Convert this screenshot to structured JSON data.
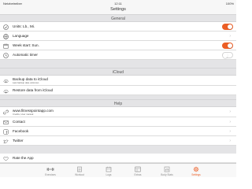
{
  "status_bar": {
    "carrier": "Netzbetreiber",
    "time": "12:11",
    "battery": "100%"
  },
  "nav": {
    "title": "Settings"
  },
  "sections": {
    "general": "General",
    "icloud": "iCloud",
    "help": "Help"
  },
  "general": {
    "units": {
      "label": "Units: Lb., Mi.",
      "on": true
    },
    "language": {
      "label": "Language"
    },
    "week_start": {
      "label": "Week start: Sun.",
      "on": true
    },
    "auto_timer": {
      "label": "Automatic timer",
      "on": false
    }
  },
  "icloud": {
    "backup": {
      "label": "Backup data to iCloud",
      "sub": "Last backup date unknown"
    },
    "restore": {
      "label": "Restore data from iCloud"
    }
  },
  "help": {
    "website": {
      "label": "www.fitnesspointapp.com",
      "sub": "Credits, User manual"
    },
    "contact": {
      "label": "Contact"
    },
    "facebook": {
      "label": "Facebook"
    },
    "twitter": {
      "label": "Twitter"
    }
  },
  "rate": {
    "label": "Rate the App"
  },
  "tabs": [
    {
      "label": "Exercises",
      "icon": "dumbbell-icon",
      "active": false
    },
    {
      "label": "Workout",
      "icon": "workout-icon",
      "active": false
    },
    {
      "label": "Logs",
      "icon": "logs-icon",
      "active": false
    },
    {
      "label": "Extras",
      "icon": "extras-icon",
      "active": false
    },
    {
      "label": "Body Stats",
      "icon": "body-stats-icon",
      "active": false
    },
    {
      "label": "Settings",
      "icon": "gear-icon",
      "active": true
    }
  ],
  "colors": {
    "accent": "#ec5e25",
    "section_bg": "#e4e4e6",
    "bar_bg": "#f7f7f7"
  }
}
